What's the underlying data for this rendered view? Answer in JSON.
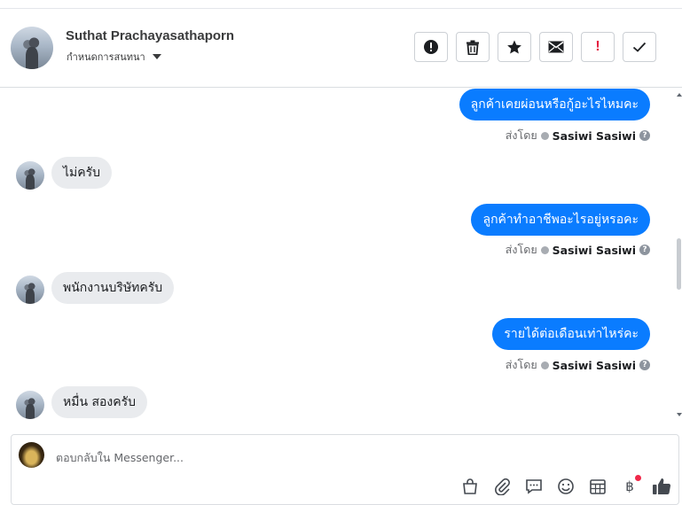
{
  "header": {
    "name": "Suthat Prachayasathaporn",
    "subtitle": "กำหนดการสนทนา",
    "actions": [
      {
        "icon": "exclamation-circle-icon"
      },
      {
        "icon": "trash-icon"
      },
      {
        "icon": "star-icon"
      },
      {
        "icon": "envelope-icon"
      },
      {
        "icon": "exclamation-mark-icon",
        "glyph": "!",
        "color": "#e41e3f"
      },
      {
        "icon": "checkmark-icon"
      }
    ]
  },
  "thread": {
    "sent_by_label": "ส่งโดย",
    "sender": "Sasiwi Sasiwi",
    "messages": [
      {
        "dir": "out",
        "text": "ลูกค้าเคยผ่อนหรือกู้อะไรไหมคะ"
      },
      {
        "dir": "in",
        "text": "ไม่ครับ"
      },
      {
        "dir": "out",
        "text": "ลูกค้าทำอาชีพอะไรอยู่หรอคะ"
      },
      {
        "dir": "in",
        "text": "พนักงานบริษัทครับ"
      },
      {
        "dir": "out",
        "text": "รายได้ต่อเดือนเท่าไหร่คะ"
      },
      {
        "dir": "in",
        "text": "หมื่น สองครับ"
      }
    ]
  },
  "composer": {
    "placeholder": "ตอบกลับใน Messenger...",
    "tools": [
      "shopping-bag-icon",
      "paperclip-icon",
      "saved-reply-icon",
      "emoji-icon",
      "calendar-icon",
      "baht-icon",
      "thumbs-up-icon"
    ],
    "baht_glyph": "฿"
  },
  "colors": {
    "accent": "#0a7cff",
    "incoming_bubble": "#e9ebee",
    "alert_red": "#e41e3f"
  }
}
